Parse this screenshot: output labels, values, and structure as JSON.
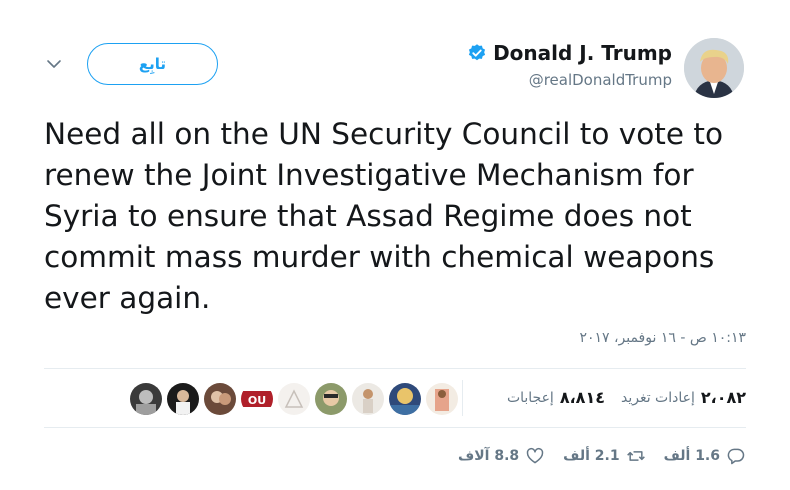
{
  "header": {
    "name": "Donald J. Trump",
    "handle": "@realDonaldTrump",
    "follow_label": "تابِع"
  },
  "tweet": {
    "text": "Need all on the UN Security Council to vote to\nrenew the Joint Investigative Mechanism for\nSyria to ensure that Assad Regime does not\ncommit mass murder with chemical weapons\never again.",
    "timestamp": "١٠:١٣ ص - ١٦ نوفمبر، ٢٠١٧"
  },
  "stats": {
    "retweets_count": "٢،٠٨٢",
    "retweets_label": "إعادات تغريد",
    "likes_count": "٨،٨١٤",
    "likes_label": "إعجابات"
  },
  "actions": {
    "replies": "1.6 ألف",
    "retweets": "2.1 ألف",
    "likes": "8.8 آلاف"
  },
  "colors": {
    "brand": "#1da1f2",
    "text": "#14171a",
    "muted": "#657786",
    "divider": "#e6ecf0"
  },
  "icons": [
    "verified-badge-icon",
    "chevron-down-icon",
    "reply-icon",
    "retweet-icon",
    "heart-icon"
  ]
}
